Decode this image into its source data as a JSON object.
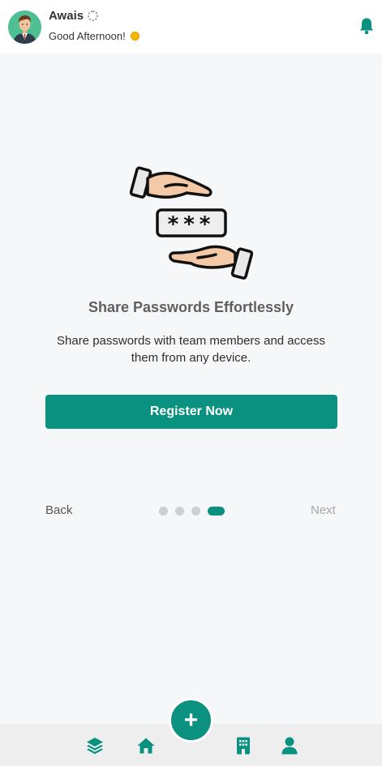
{
  "header": {
    "user_name": "Awais",
    "greeting": "Good Afternoon!"
  },
  "onboarding": {
    "title": "Share Passwords Effortlessly",
    "description": "Share passwords with team members and access them from any device.",
    "register_label": "Register Now",
    "back_label": "Back",
    "next_label": "Next",
    "pages_total": 4,
    "current_page": 4,
    "password_mask": "***"
  },
  "colors": {
    "accent": "#0a917f",
    "inactive_dot": "#cfcfcf",
    "background": "#f6f7f9"
  },
  "icons": {
    "bell": "bell-icon",
    "layers": "layers-icon",
    "home": "home-icon",
    "building": "building-icon",
    "user": "user-icon",
    "add": "plus-icon"
  }
}
